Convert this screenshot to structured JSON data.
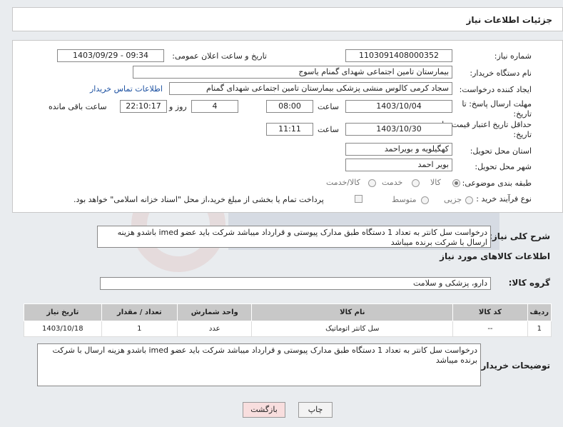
{
  "header": {
    "title": "جزئیات اطلاعات نیاز"
  },
  "fields": {
    "need_number_label": "شماره نیاز:",
    "need_number": "1103091408000352",
    "announce_label": "تاریخ و ساعت اعلان عمومی:",
    "announce_value": "1403/09/29 - 09:34",
    "buyer_org_label": "نام دستگاه خریدار:",
    "buyer_org": "بیمارستان تامین اجتماعی شهدای گمنام یاسوج",
    "requester_label": "ایجاد کننده درخواست:",
    "requester": "سجاد کرمی کالوس  منشی پزشکی  بیمارستان تامین اجتماعی شهدای گمنام",
    "contact_link": "اطلاعات تماس خریدار",
    "deadline_label": "مهلت ارسال پاسخ: تا تاریخ:",
    "deadline_date": "1403/10/04",
    "hour_label": "ساعت",
    "deadline_time": "08:00",
    "days_value": "4",
    "days_label": "روز و",
    "remaining_time": "22:10:17",
    "remaining_label": "ساعت باقی مانده",
    "validity_label": "حداقل تاریخ اعتبار قیمت: تا تاریخ:",
    "validity_date": "1403/10/30",
    "validity_time": "11:11",
    "province_label": "استان محل تحویل:",
    "province": "کهگیلویه و بویراحمد",
    "city_label": "شهر محل تحویل:",
    "city": "بویر احمد",
    "category_label": "طبقه بندی موضوعی:",
    "category_options": [
      "کالا",
      "خدمت",
      "کالا/خدمت"
    ],
    "process_label": "نوع فرآیند خرید :",
    "process_options": [
      "جزیی",
      "متوسط"
    ],
    "payment_note": "پرداخت تمام یا بخشی از مبلغ خرید،از محل \"اسناد خزانه اسلامی\" خواهد بود."
  },
  "description": {
    "label": "شرح کلی نیاز:",
    "text": "درخواست سل کانتر به تعداد 1 دستگاه طبق مدارک پیوستی و قرارداد  میباشد شرکت باید عضو imed باشدو هزینه ارسال با شرکت برنده میباشد"
  },
  "goods": {
    "section_title": "اطلاعات کالاهای مورد نیاز",
    "group_label": "گروه کالا:",
    "group_value": "دارو، پزشکی و سلامت",
    "columns": [
      "ردیف",
      "کد کالا",
      "نام کالا",
      "واحد شمارش",
      "تعداد / مقدار",
      "تاریخ نیاز"
    ],
    "rows": [
      [
        "1",
        "--",
        "سل کانتر اتوماتیک",
        "عدد",
        "1",
        "1403/10/18"
      ]
    ]
  },
  "buyer_notes": {
    "label": "توضیحات خریدار:",
    "text": "درخواست سل کانتر به تعداد 1 دستگاه طبق مدارک پیوستی و قرارداد  میباشد شرکت باید عضو imed باشدو هزینه ارسال با شرکت برنده میباشد"
  },
  "buttons": {
    "print": "چاپ",
    "back": "بازگشت"
  },
  "colors": {
    "background": "#e9ecef",
    "link": "#1a4fa0",
    "table_header": "#c8c8c8",
    "back_button": "#f8dede"
  }
}
